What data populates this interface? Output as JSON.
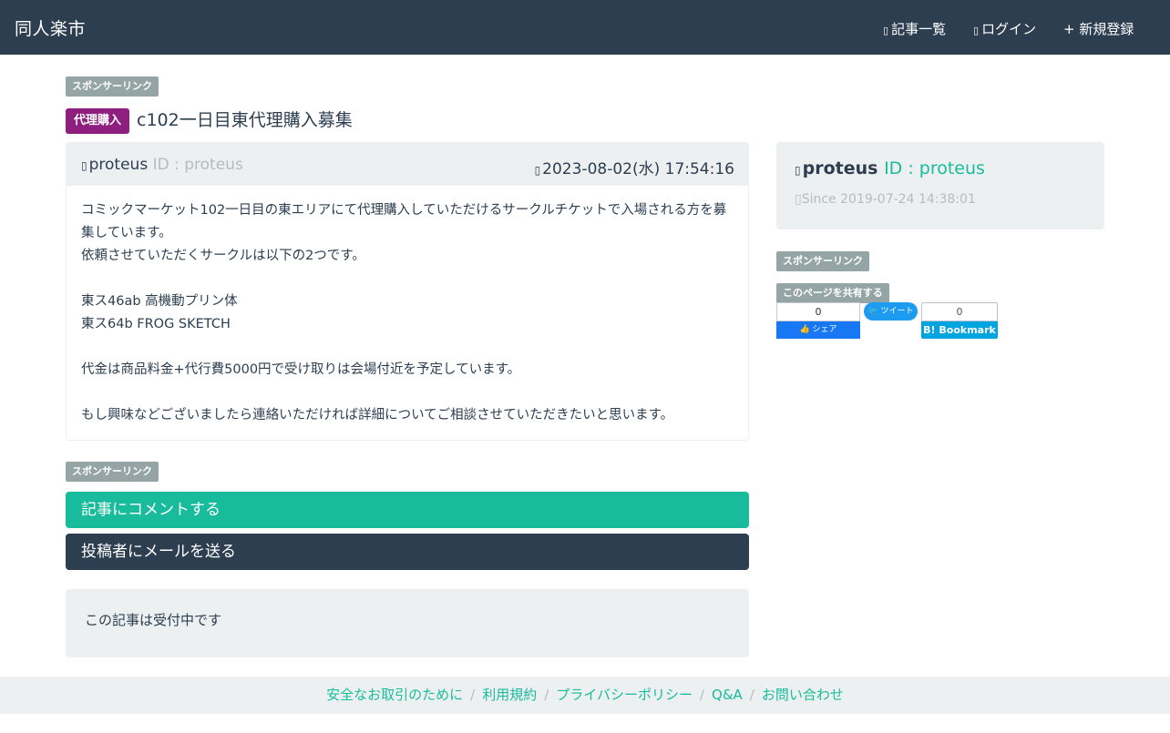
{
  "navbar": {
    "brand": "同人楽市",
    "items": [
      {
        "icon": "list-icon",
        "label": "記事一覧"
      },
      {
        "icon": "sign-in-icon",
        "label": "ログイン"
      },
      {
        "icon": "plus-icon",
        "label": "新規登録"
      }
    ]
  },
  "ads": {
    "sponsor_label": "スポンサーリンク",
    "share_label": "このページを共有する"
  },
  "post": {
    "category": "代理購入",
    "title": "c102一日目東代理購入募集",
    "author_name": "proteus",
    "author_id": "ID : proteus",
    "date": "2023-08-02(水) 17:54:16",
    "body": "コミックマーケット102一日目の東エリアにて代理購入していただけるサークルチケットで入場される方を募集しています。\n依頼させていただくサークルは以下の2つです。\n\n東ス46ab 高機動プリン体\n東ス64b FROG SKETCH\n\n代金は商品料金+代行費5000円で受け取りは会場付近を予定しています。\n\nもし興味などございましたら連絡いただければ詳細についてご相談させていただきたいと思います。"
  },
  "actions": {
    "comment": "記事にコメントする",
    "mail": "投稿者にメールを送る"
  },
  "status": "この記事は受付中です",
  "profile": {
    "name": "proteus",
    "id": "ID : proteus",
    "since": "Since 2019-07-24 14:38:01"
  },
  "share": {
    "fb_count": "0",
    "fb_label": "シェア",
    "tw_label": "ツイート",
    "hb_count": "0",
    "hb_label": "B! Bookmark"
  },
  "footer": {
    "links": [
      "安全なお取引のために",
      "利用規約",
      "プライバシーポリシー",
      "Q&A",
      "お問い合わせ"
    ]
  },
  "colors": {
    "primary": "#2c3e50",
    "success": "#18bc9c",
    "muted": "#95a5a6",
    "category": "#8e1f7e",
    "light": "#ecf0f1"
  }
}
